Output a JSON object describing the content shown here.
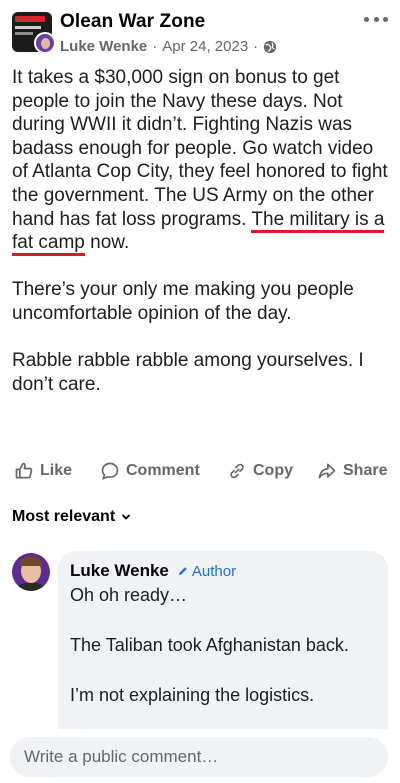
{
  "post": {
    "group_name": "Olean War Zone",
    "author": "Luke Wenke",
    "separator": "·",
    "date": "Apr 24, 2023",
    "separator2": "·",
    "privacy_icon": "globe-icon",
    "text_lines": {
      "p1_before": "It takes a $30,000 sign on bonus to get people to join the Navy these days.  Not during WWII it didn’t.  Fighting Nazis was badass enough for people.  Go watch video of Atlanta Cop City, they feel honored to fight the government.  The US Army on the other hand has fat loss programs.  ",
      "p1_underlined": "The military is a fat camp",
      "p1_after": " now.",
      "p2": "There’s your only me making you people uncomfortable opinion of the day.",
      "p3": "Rabble rabble rabble among yourselves.  I don’t care."
    },
    "underline_color": "#d91a2a"
  },
  "actions": {
    "like": "Like",
    "comment": "Comment",
    "copy": "Copy",
    "share": "Share"
  },
  "comments_section": {
    "sort_label": "Most relevant",
    "comment": {
      "name": "Luke Wenke",
      "badge": "Author",
      "p1": "Oh oh ready…",
      "p2": "The Taliban took Afghanistan back.",
      "p3": "I’m not explaining the logistics."
    }
  },
  "composer": {
    "placeholder": "Write a public comment…"
  },
  "colors": {
    "text": "#050505",
    "secondary": "#65676b",
    "author_badge": "#1d6fe0",
    "bubble_bg": "#f0f2f5"
  }
}
